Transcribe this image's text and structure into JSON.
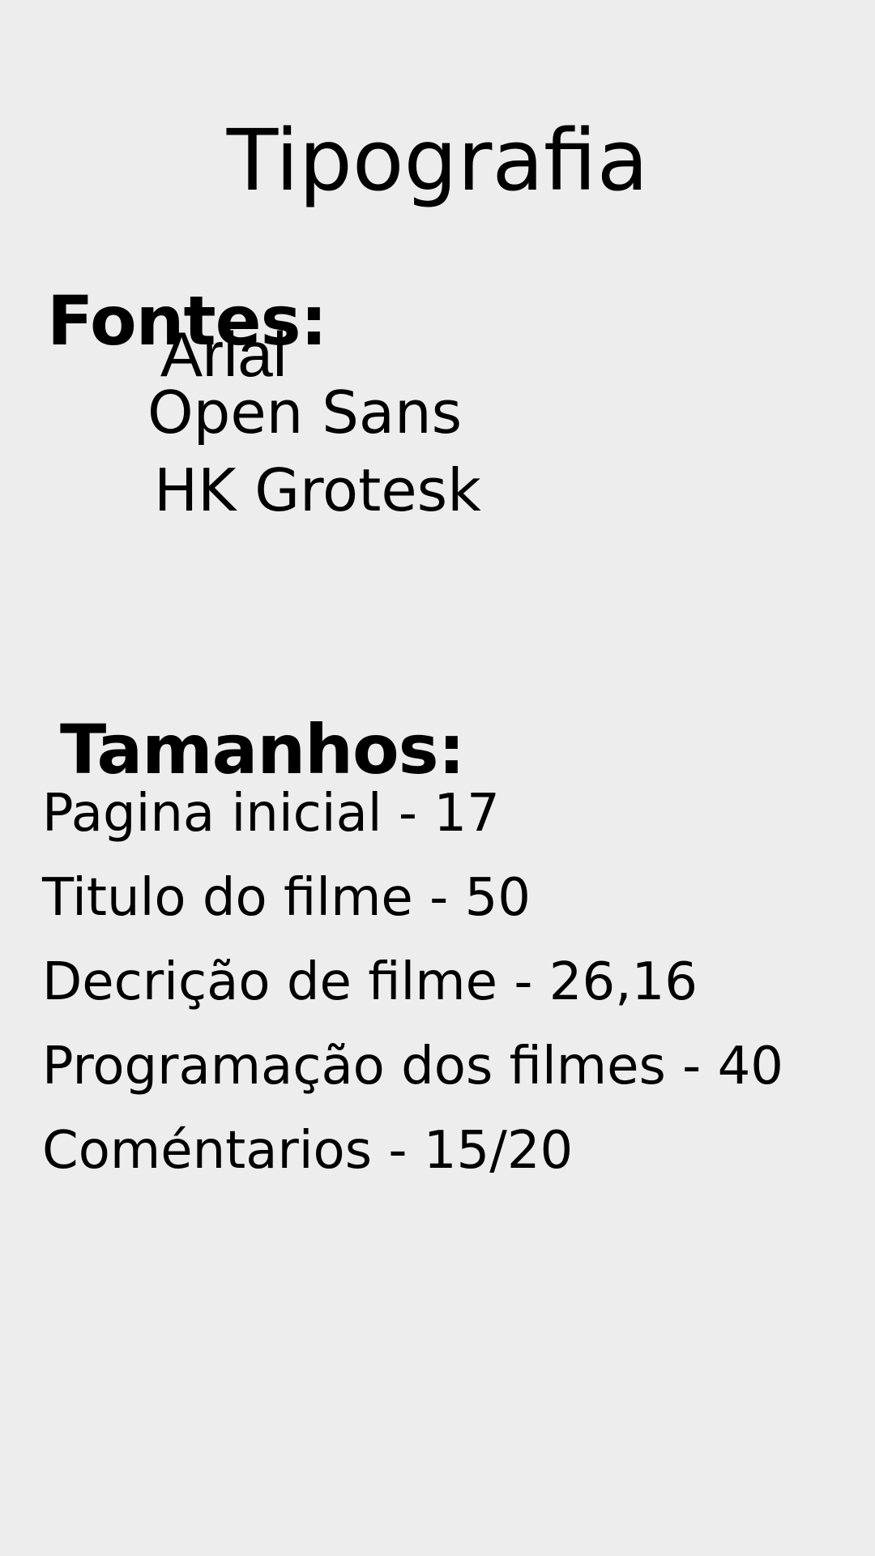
{
  "title": "Tipografia",
  "fonts": {
    "heading": "Fontes:",
    "items": [
      "Arial",
      "Open Sans",
      "HK Grotesk"
    ]
  },
  "sizes": {
    "heading": "Tamanhos:",
    "items": [
      "Pagina inicial - 17",
      "Titulo do filme - 50",
      "Decrição de filme - 26,16",
      "Programação dos filmes - 40",
      "Coméntarios - 15/20"
    ]
  },
  "colors": {
    "background": "#ededed",
    "text": "#000000"
  }
}
